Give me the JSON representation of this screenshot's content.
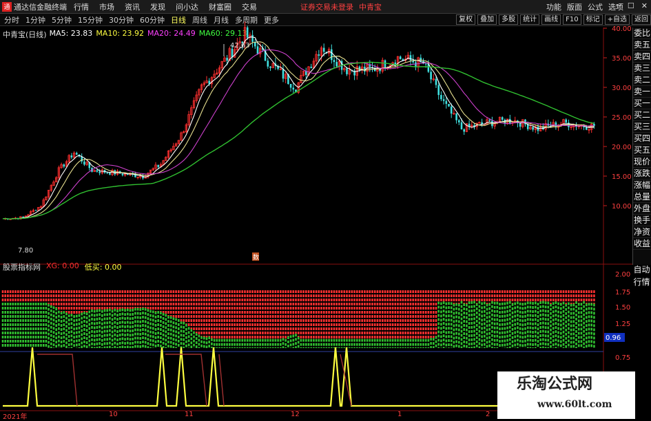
{
  "titlebar": {
    "app_title": "通达信金融终端",
    "menu": [
      "行情",
      "市场",
      "资讯",
      "发现",
      "问小达",
      "财富圈",
      "交易"
    ],
    "notice": "证券交易未登录",
    "stock_name": "中青宝",
    "right_menu": [
      "功能",
      "版面",
      "公式",
      "选项"
    ]
  },
  "toolbar": {
    "periods": [
      "分时",
      "1分钟",
      "5分钟",
      "15分钟",
      "30分钟",
      "60分钟",
      "日线",
      "周线",
      "月线",
      "多周期",
      "更多"
    ],
    "active_period": "日线",
    "tools": [
      "复权",
      "叠加",
      "多股",
      "统计",
      "画线",
      "F10",
      "标记",
      "+自选",
      "返回"
    ]
  },
  "main_chart": {
    "name": "中青宝(日线)",
    "ma": [
      {
        "label": "MA5: 23.83",
        "color": "#ffffff"
      },
      {
        "label": "MA10: 23.92",
        "color": "#ffff40"
      },
      {
        "label": "MA20: 24.49",
        "color": "#ff40ff"
      },
      {
        "label": "MA60: 29.13",
        "color": "#40ff40"
      }
    ],
    "yticks": [
      "40.00",
      "35.00",
      "30.00",
      "25.00",
      "20.00",
      "15.00",
      "10.00"
    ],
    "high_label": "42.63",
    "low_label": "7.80",
    "marker": "数"
  },
  "right_panel": [
    "委比",
    "卖五",
    "卖四",
    "卖三",
    "卖二",
    "卖一",
    "买一",
    "买二",
    "买三",
    "买四",
    "买五",
    "现价",
    "涨跌",
    "涨幅",
    "总量",
    "外盘",
    "换手",
    "净资",
    "收益"
  ],
  "right_panel2": [
    "自动",
    "行情"
  ],
  "indicator": {
    "name": "股票指标网",
    "items": [
      {
        "label": "XG: 0.00",
        "color": "#ff3030"
      },
      {
        "label": "低买: 0.00",
        "color": "#ffff40"
      }
    ],
    "yticks": [
      "2.00",
      "1.75",
      "1.50",
      "1.25",
      "0.96",
      "0.75"
    ]
  },
  "dates": [
    "2021年",
    "10",
    "11",
    "12",
    "1",
    "2"
  ],
  "watermark": {
    "line1": "乐淘公式网",
    "line2": "www.60lt.com"
  },
  "colors": {
    "up": "#ff3030",
    "down": "#40e0e0",
    "ma60": "#30c030",
    "ma20": "#cc40cc"
  }
}
